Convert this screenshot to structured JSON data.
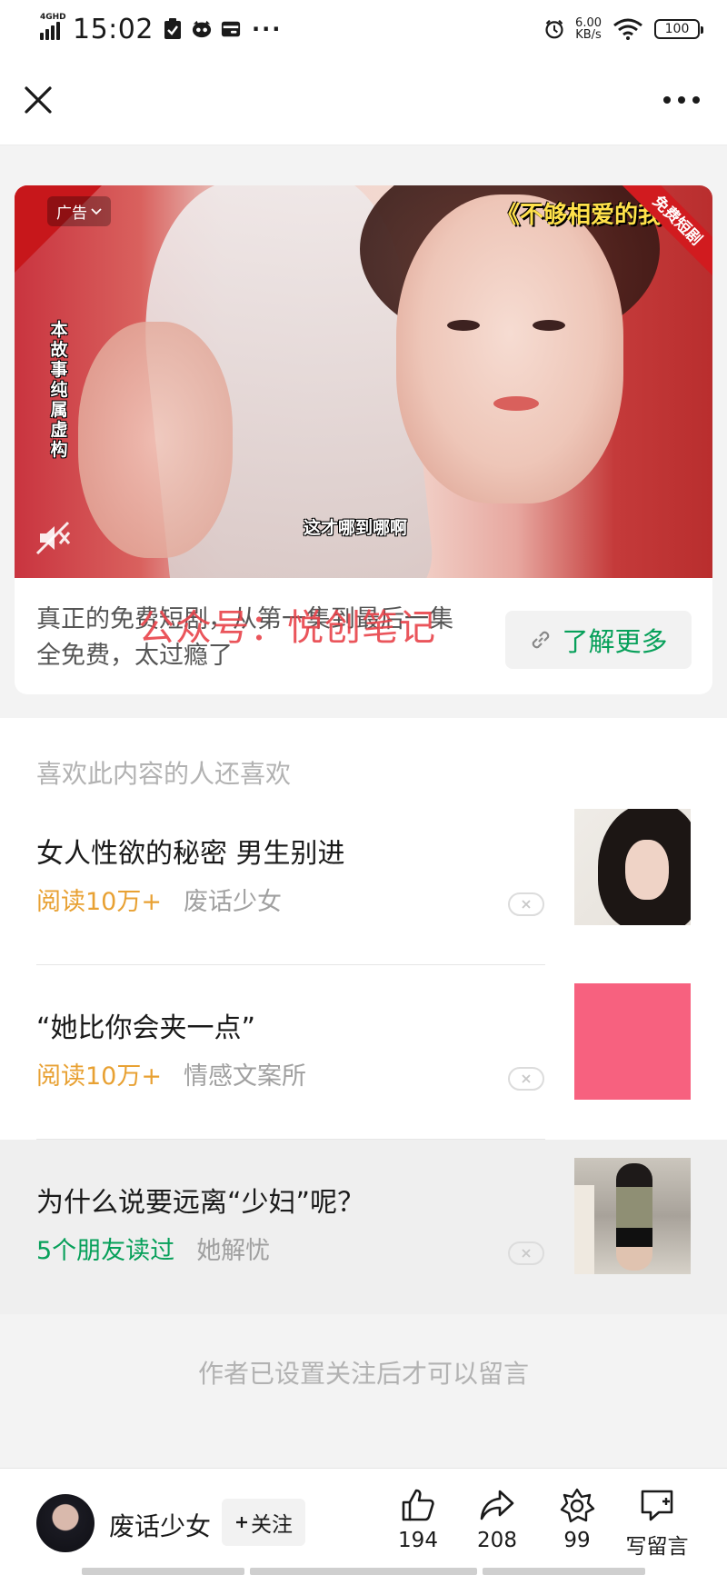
{
  "status_bar": {
    "network": "4GHD",
    "time": "15:02",
    "dots": "···",
    "speed_value": "6.00",
    "speed_unit": "KB/s",
    "battery": "100"
  },
  "top_bar": {
    "close_icon": "close-icon",
    "more_icon": "more-icon"
  },
  "ad": {
    "badge_label": "广告",
    "overlay_title": "《不够相爱的我",
    "ribbon_label": "免费短剧",
    "vertical_notice": "本故事纯属虚构",
    "subtitle": "这才哪到哪啊",
    "description": "真正的免费短剧，从第一集到最后一集全免费，太过瘾了",
    "watermark": "公众号：悦创笔记",
    "cta_label": "了解更多"
  },
  "recommendations": {
    "header": "喜欢此内容的人还喜欢",
    "items": [
      {
        "title": "女人性欲的秘密 男生别进",
        "stat": "阅读10万+",
        "author": "废话少女"
      },
      {
        "title": "“她比你会夹一点”",
        "stat": "阅读10万+",
        "author": "情感文案所"
      },
      {
        "title": "为什么说要远离“少妇”呢？",
        "stat": "5个朋友读过",
        "author": "她解忧"
      }
    ]
  },
  "comments_note": "作者已设置关注后才可以留言",
  "bottom_bar": {
    "author_name": "废话少女",
    "follow_label": "关注",
    "like_count": "194",
    "share_count": "208",
    "wow_count": "99",
    "comment_label": "写留言"
  },
  "colors": {
    "accent_green": "#07a05a",
    "read_orange": "#e8a133",
    "watermark_red": "#e8434a",
    "ad_red": "#c7171b"
  }
}
